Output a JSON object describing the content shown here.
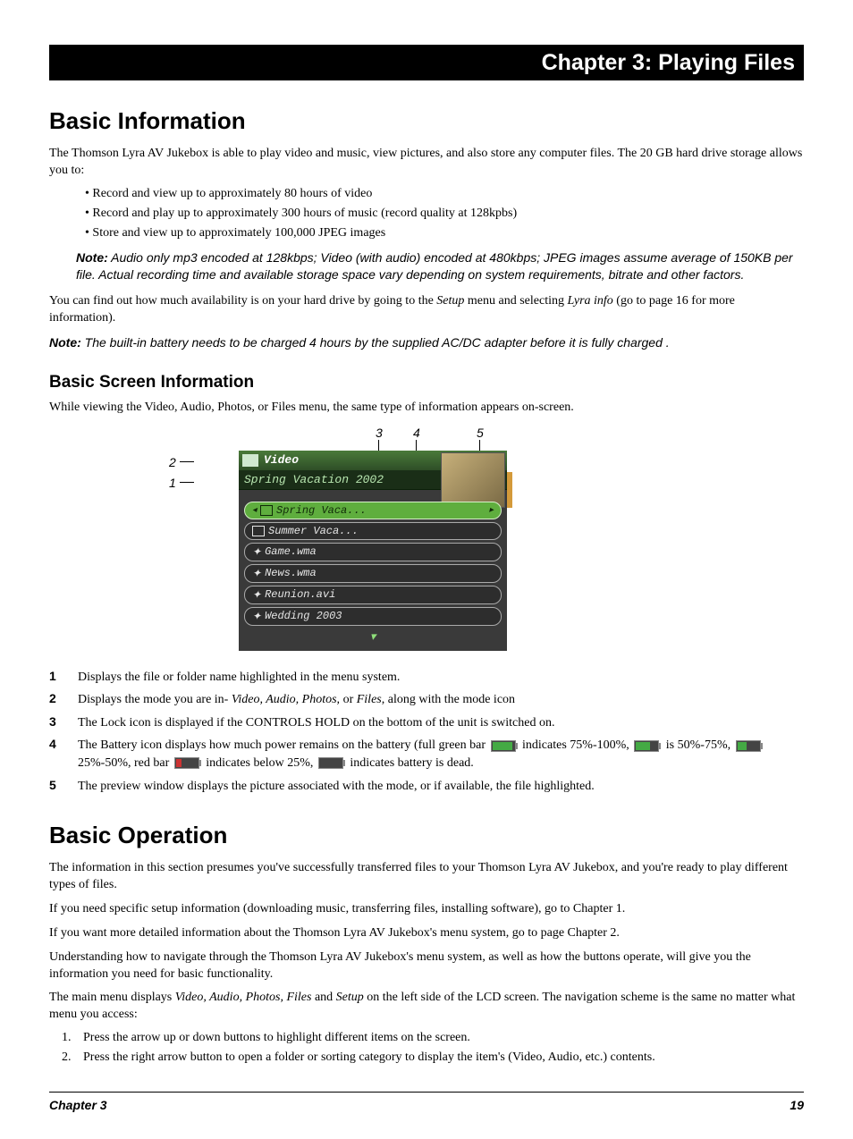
{
  "chapter_banner": "Chapter 3: Playing Files",
  "h1_basic_info": "Basic Information",
  "intro": "The Thomson Lyra AV Jukebox is able to play video and music, view pictures, and also store any computer files. The 20 GB hard drive storage allows you to:",
  "bullets": [
    "Record and view up to approximately 80 hours of video",
    "Record and play up to approximately 300 hours of music (record quality at 128kpbs)",
    "Store and view up to approximately 100,000 JPEG images"
  ],
  "note1_label": "Note:",
  "note1_body": " Audio only mp3 encoded at 128kbps; Video (with audio) encoded at 480kbps; JPEG images assume average of 150KB per file. Actual recording time and available storage space vary depending on system requirements, bitrate and other factors.",
  "availability_pre": "You can find out how much availability is on your hard drive by going to the ",
  "availability_setup": "Setup",
  "availability_mid": " menu and selecting ",
  "availability_lyra": "Lyra info",
  "availability_post": " (go to page 16 for more information).",
  "note2_label": "Note:",
  "note2_body": " The built-in battery needs to be charged 4 hours by the supplied AC/DC adapter before it is fully charged .",
  "h2_screen": "Basic Screen Information",
  "screen_intro": "While viewing the Video, Audio, Photos, or Files menu, the same type of information appears on-screen.",
  "callouts_top": {
    "c3": "3",
    "c4": "4",
    "c5": "5"
  },
  "callouts_left": {
    "c1": "1",
    "c2": "2"
  },
  "screen": {
    "mode": "Video",
    "path": "Spring Vacation 2002",
    "items": [
      {
        "label": "Spring Vaca...",
        "sel": true,
        "icon": "folder"
      },
      {
        "label": "Summer Vaca...",
        "icon": "folder"
      },
      {
        "label": "Game.wma",
        "icon": "media"
      },
      {
        "label": "News.wma",
        "icon": "media"
      },
      {
        "label": "Reunion.avi",
        "icon": "media"
      },
      {
        "label": "Wedding 2003",
        "icon": "media"
      }
    ]
  },
  "defs": {
    "d1": "Displays the file or folder name highlighted in the menu system.",
    "d2_pre": "Displays the mode you are in- ",
    "d2_em": "Video, Audio, Photos,",
    "d2_mid": " or ",
    "d2_em2": "Files",
    "d2_post": ", along with the mode icon",
    "d3": "The Lock icon is displayed if the CONTROLS HOLD on the bottom of the unit is switched on.",
    "d4_a": "The Battery icon displays how much power remains on the battery (full green bar ",
    "d4_b": " indicates 75%-100%, ",
    "d4_c": " is 50%-75%, ",
    "d4_d": " 25%-50%, red bar ",
    "d4_e": " indicates below 25%, ",
    "d4_f": " indicates battery is dead.",
    "d5": "The preview window displays the picture associated with the mode, or if available, the file highlighted."
  },
  "def_nums": {
    "n1": "1",
    "n2": "2",
    "n3": "3",
    "n4": "4",
    "n5": "5"
  },
  "h1_basic_op": "Basic Operation",
  "op_p1": "The information in this section presumes you've successfully transferred files to your Thomson Lyra AV Jukebox, and you're ready to play different types of files.",
  "op_p2": "If you need specific setup information (downloading music, transferring files, installing software), go to Chapter 1.",
  "op_p3": "If you want more detailed information about the Thomson Lyra AV Jukebox's menu system, go to page Chapter 2.",
  "op_p4": "Understanding how to navigate through the Thomson Lyra AV Jukebox's menu system, as well as how the buttons operate, will give you the information you need for basic functionality.",
  "op_p5_pre": "The main menu displays ",
  "op_p5_em": "Video, Audio, Photos, Files",
  "op_p5_mid": " and ",
  "op_p5_em2": "Setup",
  "op_p5_post": " on the left side of the LCD screen. The navigation scheme is the same no matter what menu you access:",
  "steps": [
    "Press the arrow up or down buttons to highlight different items on the screen.",
    "Press the right arrow button to open a folder or sorting category to display the item's (Video, Audio, etc.) contents."
  ],
  "footer_left": "Chapter 3",
  "footer_right": "19"
}
